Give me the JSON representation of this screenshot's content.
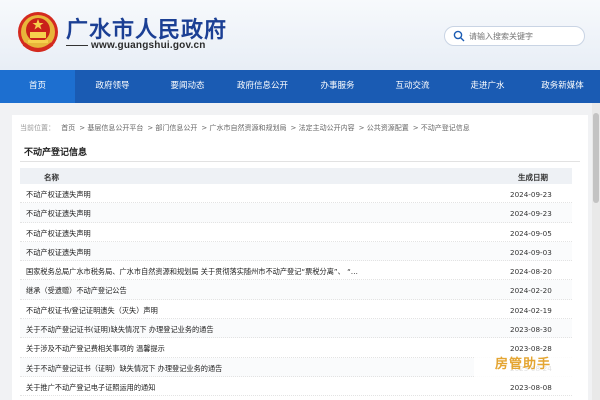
{
  "header": {
    "title": "广水市人民政府",
    "url": "www.guangshui.gov.cn",
    "search_placeholder": "请输入搜索关键字",
    "brand_color": "#1b3f94"
  },
  "nav": {
    "items": [
      "首页",
      "政府领导",
      "要闻动态",
      "政府信息公开",
      "办事服务",
      "互动交流",
      "走进广水",
      "政务新媒体"
    ],
    "active_index": 0,
    "bg_color": "#1a5bb3"
  },
  "breadcrumb": {
    "label": "当前位置：",
    "items": [
      "首页",
      "> 基层信息公开平台",
      "> 部门信息公开",
      "> 广水市自然资源和规划局",
      "> 法定主动公开内容",
      "> 公共资源配置",
      "> 不动产登记信息"
    ]
  },
  "section": {
    "title": "不动产登记信息"
  },
  "table": {
    "headers": [
      "名称",
      "生成日期"
    ],
    "rows": [
      {
        "title": "不动产权证遗失声明",
        "date": "2024-09-23"
      },
      {
        "title": "不动产权证遗失声明",
        "date": "2024-09-23"
      },
      {
        "title": "不动产权证遗失声明",
        "date": "2024-09-05"
      },
      {
        "title": "不动产权证遗失声明",
        "date": "2024-09-03"
      },
      {
        "title": "国家税务总局广水市税务局、广水市自然资源和规划局 关于贯彻落实随州市不动产登记“票税分离”、 “…",
        "date": "2024-08-20"
      },
      {
        "title": "继承（受遗赠）不动产登记公告",
        "date": "2024-02-20"
      },
      {
        "title": "不动产权证书/登记证明遗失（灭失）声明",
        "date": "2024-02-19"
      },
      {
        "title": "关于不动产登记证书(证明)缺失情况下 办理登记业务的通告",
        "date": "2023-08-30"
      },
      {
        "title": "关于涉及不动产登记费相关事项的 温馨提示",
        "date": "2023-08-28"
      },
      {
        "title": "关于不动产登记证书（证明）缺失情况下 办理登记业务的通告",
        "date": "2023-08-24"
      },
      {
        "title": "关于推广不动产登记电子证照运用的通知",
        "date": "2023-08-08"
      }
    ]
  },
  "watermark": {
    "text": "房管助手",
    "color": "#e4a532"
  }
}
